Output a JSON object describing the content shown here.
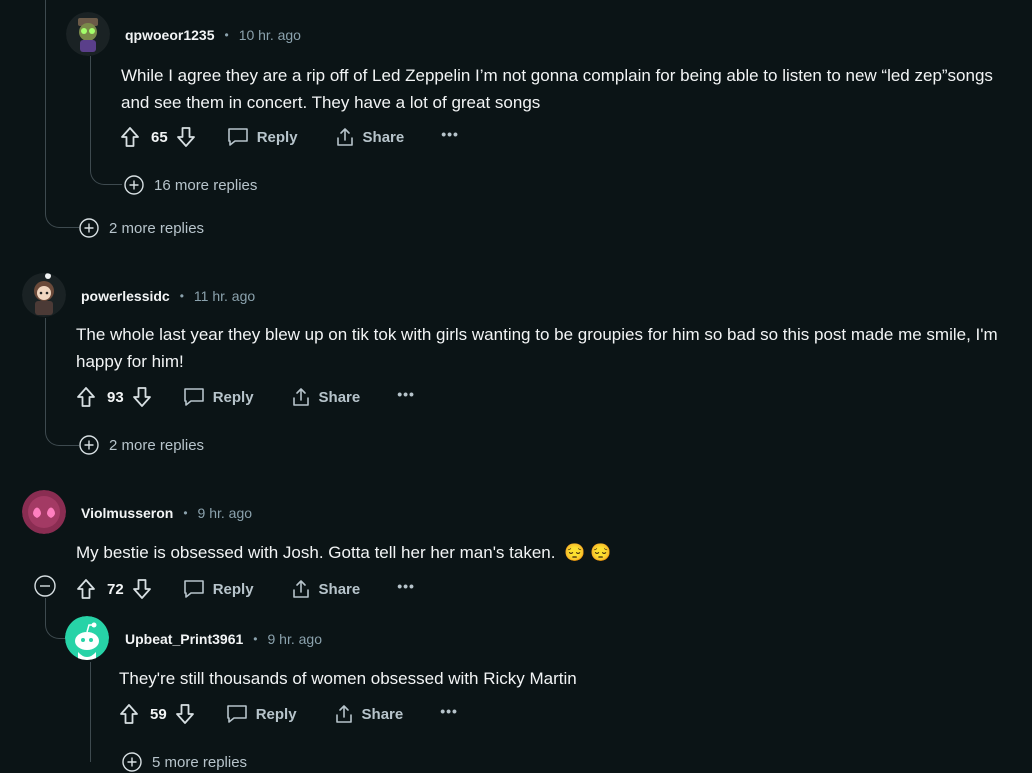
{
  "comments": [
    {
      "username": "qpwoeor1235",
      "time": "10 hr. ago",
      "text": "While I agree they are a rip off of Led Zeppelin I’m not gonna complain for being able to listen to new “led zep”songs and see them in concert. They have a lot of great songs",
      "score": "65",
      "more_replies": "16 more replies"
    },
    {
      "username": "powerlessidc",
      "time": "11 hr. ago",
      "text": "The whole last year they blew up on tik tok with girls wanting to be groupies for him so bad so this post made me smile, I'm happy for him!",
      "score": "93",
      "more_replies": "2 more replies"
    },
    {
      "username": "Violmusseron",
      "time": "9 hr. ago",
      "text": "My bestie is obsessed with Josh. Gotta tell her her man's taken.",
      "emoji": "😔 😔",
      "score": "72"
    },
    {
      "username": "Upbeat_Print3961",
      "time": "9 hr. ago",
      "text": "They're still thousands of women obsessed with Ricky Martin",
      "score": "59",
      "more_replies": "5 more replies"
    }
  ],
  "thread_more_replies": "2 more replies",
  "labels": {
    "reply": "Reply",
    "share": "Share",
    "more": "•••",
    "dot": "•"
  },
  "colors": {
    "background": "#0b1416",
    "text": "#f2f4f5",
    "meta": "#8ba2ad",
    "thread_line": "#3e4a4f",
    "snoo_green": "#27d3a7"
  },
  "icons": [
    "upvote-icon",
    "downvote-icon",
    "comment-icon",
    "share-icon",
    "plus-circle-icon",
    "minus-circle-icon"
  ]
}
